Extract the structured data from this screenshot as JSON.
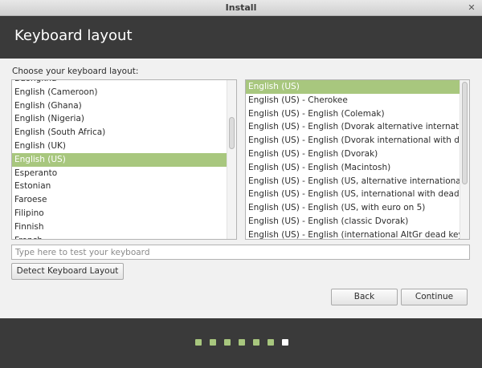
{
  "window": {
    "title": "Install",
    "close_glyph": "✕"
  },
  "header": {
    "title": "Keyboard layout"
  },
  "prompt": "Choose your keyboard layout:",
  "layouts": {
    "items": [
      "Dzongkha",
      "English (Cameroon)",
      "English (Ghana)",
      "English (Nigeria)",
      "English (South Africa)",
      "English (UK)",
      "English (US)",
      "Esperanto",
      "Estonian",
      "Faroese",
      "Filipino",
      "Finnish",
      "French"
    ],
    "selected": "English (US)"
  },
  "variants": {
    "items": [
      "English (US)",
      "English (US) - Cherokee",
      "English (US) - English (Colemak)",
      "English (US) - English (Dvorak alternative international",
      "English (US) - English (Dvorak international with dead k",
      "English (US) - English (Dvorak)",
      "English (US) - English (Macintosh)",
      "English (US) - English (US, alternative international)",
      "English (US) - English (US, international with dead keys",
      "English (US) - English (US, with euro on 5)",
      "English (US) - English (classic Dvorak)",
      "English (US) - English (international AltGr dead keys)"
    ],
    "selected": "English (US)"
  },
  "test_input": {
    "placeholder": "Type here to test your keyboard",
    "value": ""
  },
  "buttons": {
    "detect": "Detect Keyboard Layout",
    "back": "Back",
    "continue": "Continue"
  },
  "progress": {
    "total_steps": 7,
    "current_step": 7
  },
  "colors": {
    "accent": "#a8c77e",
    "header_bg": "#3a3a3a",
    "content_bg": "#f1f1f1"
  }
}
